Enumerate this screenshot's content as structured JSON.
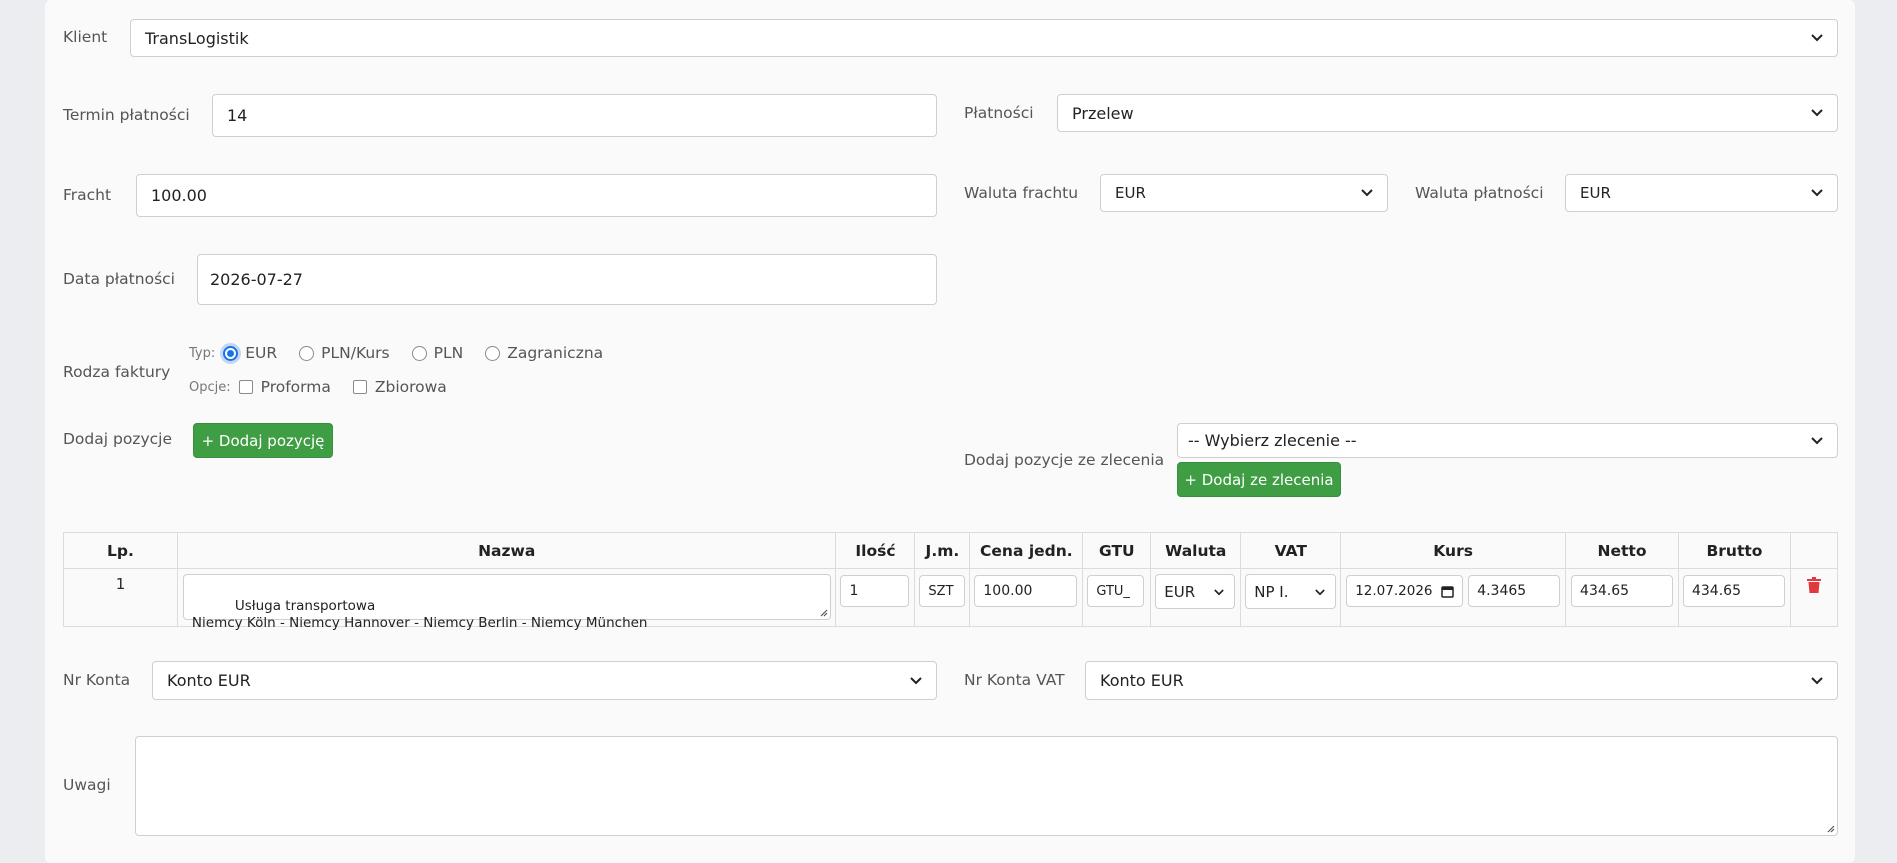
{
  "klient": {
    "label": "Klient",
    "value": "TransLogistik"
  },
  "termin": {
    "label": "Termin płatności",
    "value": "14"
  },
  "platnosci": {
    "label": "Płatności",
    "value": "Przelew"
  },
  "fracht": {
    "label": "Fracht",
    "value": "100.00"
  },
  "waluta_frachtu": {
    "label": "Waluta frachtu",
    "value": "EUR"
  },
  "waluta_platnosci": {
    "label": "Waluta płatności",
    "value": "EUR"
  },
  "data_platnosci": {
    "label": "Data płatności",
    "value": "2026-07-27"
  },
  "rodzaj_faktury": {
    "label": "Rodza faktury",
    "typ_label": "Typ:",
    "types": [
      {
        "label": "EUR",
        "selected": true
      },
      {
        "label": "PLN/Kurs",
        "selected": false
      },
      {
        "label": "PLN",
        "selected": false
      },
      {
        "label": "Zagraniczna",
        "selected": false
      }
    ],
    "opcje_label": "Opcje:",
    "options": [
      {
        "label": "Proforma",
        "checked": false
      },
      {
        "label": "Zbiorowa",
        "checked": false
      }
    ]
  },
  "dodaj_pozycje": {
    "label": "Dodaj pozycje",
    "button": "+ Dodaj pozycję"
  },
  "dodaj_ze_zlecenia": {
    "label": "Dodaj pozycje ze zlecenia",
    "select": "-- Wybierz zlecenie --",
    "button": "+ Dodaj ze zlecenia"
  },
  "table": {
    "headers": [
      "Lp.",
      "Nazwa",
      "Ilość",
      "J.m.",
      "Cena jedn.",
      "GTU",
      "Waluta",
      "VAT",
      "Kurs",
      "Netto",
      "Brutto",
      ""
    ],
    "rows": [
      {
        "lp": "1",
        "nazwa": "Usługa transportowa\nNiemcy Köln - Niemcy Hannover - Niemcy Berlin - Niemcy München",
        "ilosc": "1",
        "jm": "SZT",
        "cena": "100.00",
        "gtu": "GTU_",
        "waluta": "EUR",
        "vat": "NP I.",
        "kurs_data": "12.07.2026",
        "kurs": "4.3465",
        "netto": "434.65",
        "brutto": "434.65"
      }
    ]
  },
  "nr_konta": {
    "label": "Nr Konta",
    "value": "Konto EUR"
  },
  "nr_konta_vat": {
    "label": "Nr Konta VAT",
    "value": "Konto EUR"
  },
  "uwagi": {
    "label": "Uwagi",
    "value": ""
  },
  "colors": {
    "primary_blue": "#1a73e8",
    "green": "#3f9e44",
    "delete_red": "#e0393e"
  }
}
